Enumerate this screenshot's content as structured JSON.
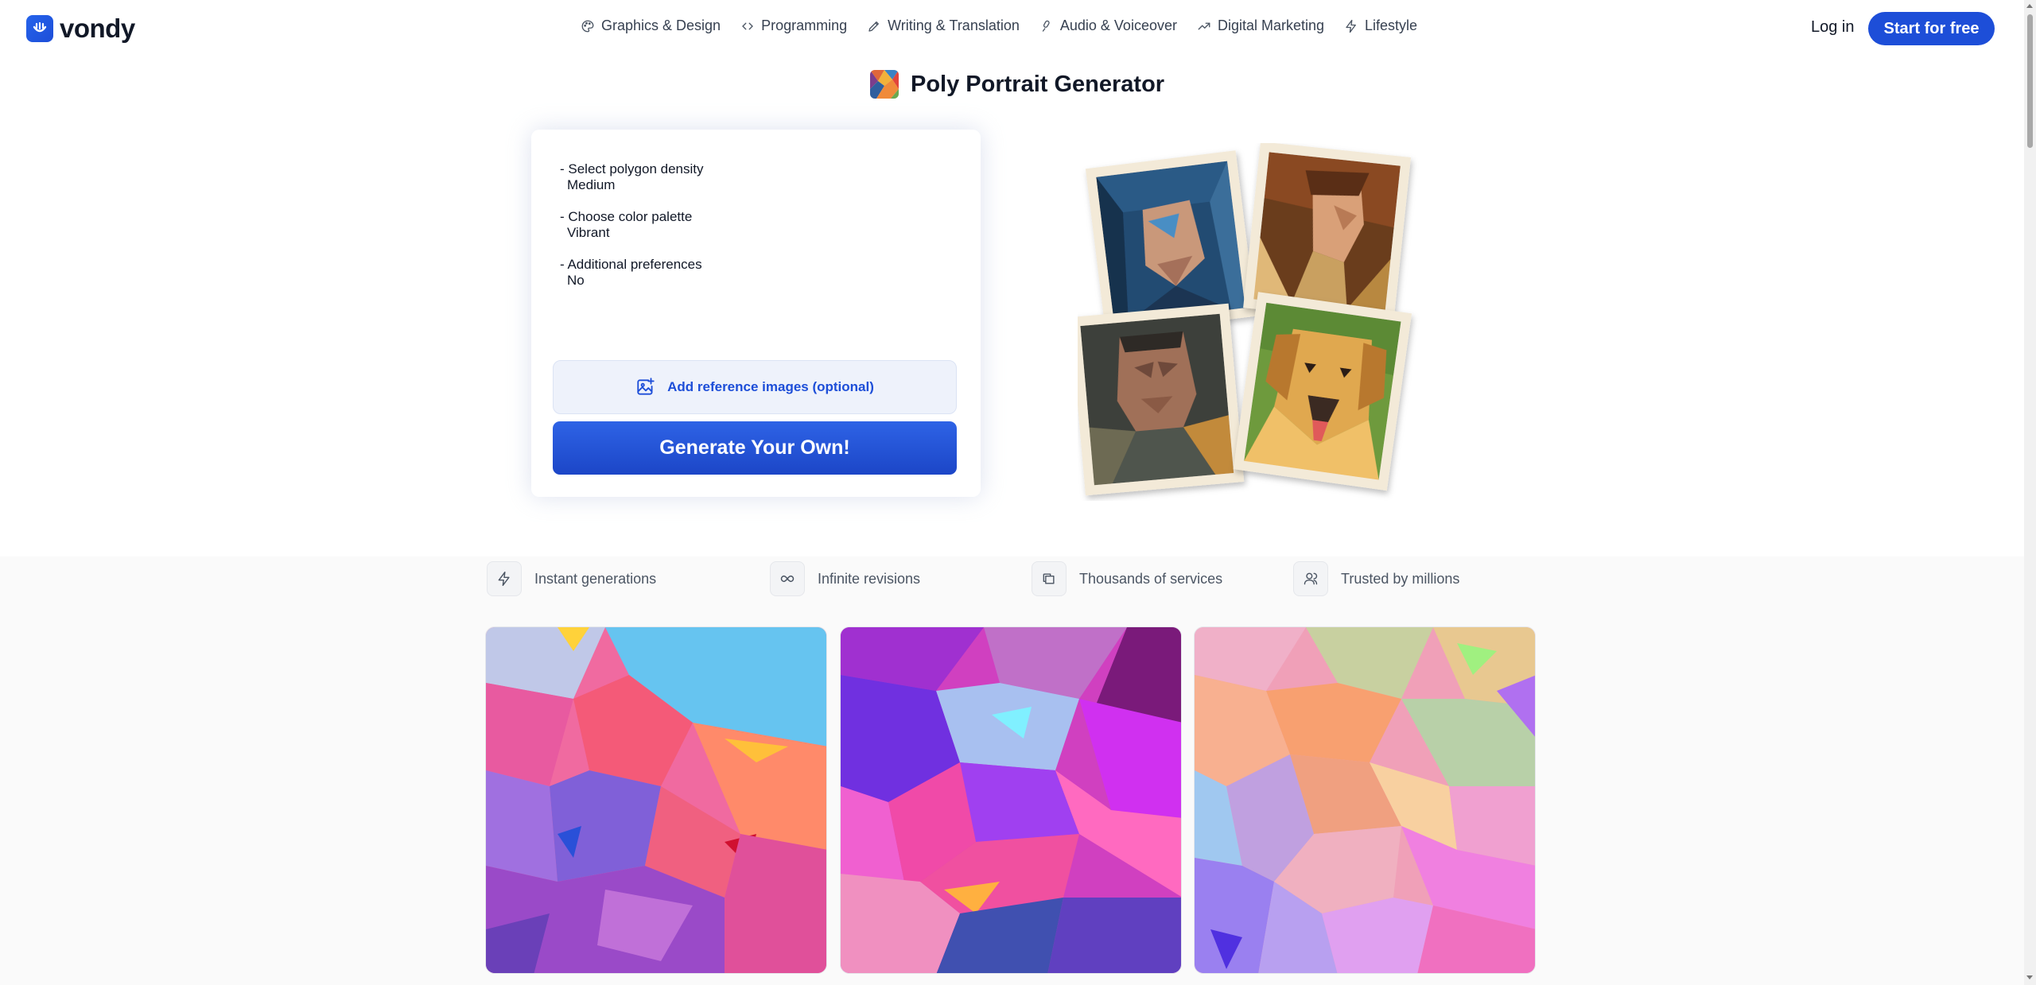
{
  "header": {
    "logo_text": "vondy",
    "nav": [
      {
        "label": "Graphics & Design",
        "icon": "palette-icon"
      },
      {
        "label": "Programming",
        "icon": "code-icon"
      },
      {
        "label": "Writing & Translation",
        "icon": "pen-icon"
      },
      {
        "label": "Audio & Voiceover",
        "icon": "microphone-icon"
      },
      {
        "label": "Digital Marketing",
        "icon": "trending-up-icon"
      },
      {
        "label": "Lifestyle",
        "icon": "bolt-icon"
      }
    ],
    "login_label": "Log in",
    "start_label": "Start for free"
  },
  "page": {
    "title": "Poly Portrait Generator"
  },
  "form": {
    "options": [
      {
        "label": "- Select polygon density",
        "value": "Medium"
      },
      {
        "label": "- Choose color palette",
        "value": "Vibrant"
      },
      {
        "label": "- Additional preferences",
        "value": "No"
      }
    ],
    "reference_label": "Add reference images (optional)",
    "generate_label": "Generate Your Own!"
  },
  "features": [
    {
      "label": "Instant generations",
      "icon": "bolt-icon"
    },
    {
      "label": "Infinite revisions",
      "icon": "infinity-icon"
    },
    {
      "label": "Thousands of services",
      "icon": "folders-icon"
    },
    {
      "label": "Trusted by millions",
      "icon": "users-icon"
    }
  ],
  "colors": {
    "accent": "#1d4ed8",
    "button_gradient_top": "#2e63e6",
    "button_gradient_bottom": "#1c46c7"
  }
}
